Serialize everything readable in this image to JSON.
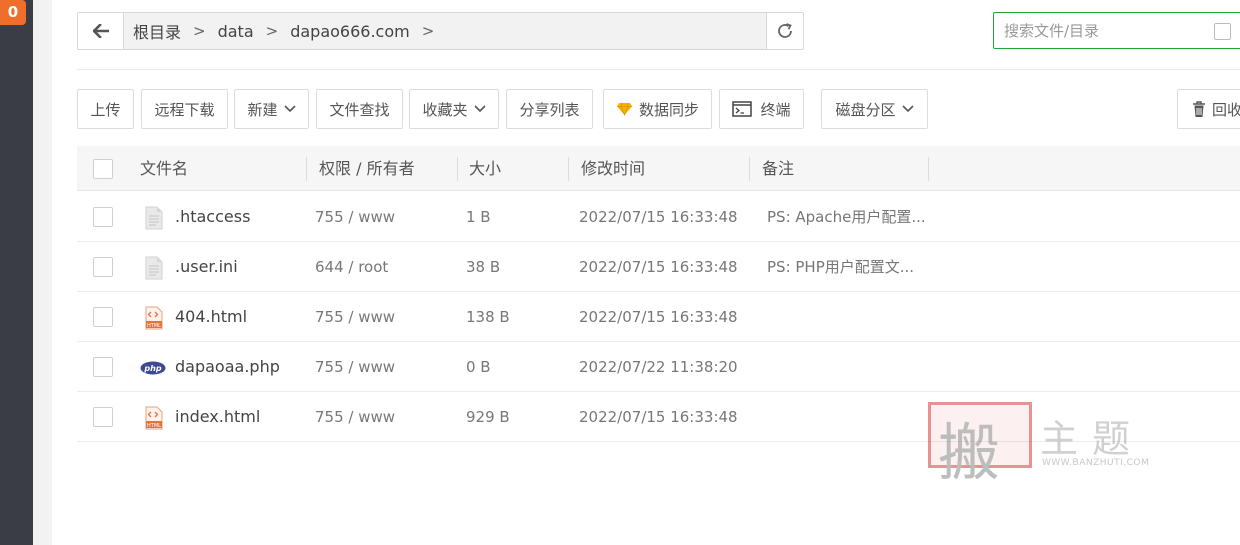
{
  "sidebar": {
    "badge": "0"
  },
  "pathbar": {
    "crumbs": [
      "根目录",
      "data",
      "dapao666.com"
    ],
    "separator": ">"
  },
  "search": {
    "placeholder": "搜索文件/目录"
  },
  "toolbar": {
    "upload": "上传",
    "remote_download": "远程下载",
    "new": "新建",
    "file_search": "文件查找",
    "favorites": "收藏夹",
    "share_list": "分享列表",
    "data_sync": "数据同步",
    "terminal": "终端",
    "disk_partition": "磁盘分区",
    "recycle": "回收"
  },
  "table": {
    "headers": {
      "name": "文件名",
      "perm": "权限 / 所有者",
      "size": "大小",
      "mtime": "修改时间",
      "note": "备注"
    },
    "rows": [
      {
        "icon": "text-file-icon",
        "name": ".htaccess",
        "perm": "755 / www",
        "size": "1 B",
        "mtime": "2022/07/15 16:33:48",
        "note": "PS: Apache用户配置..."
      },
      {
        "icon": "text-file-icon",
        "name": ".user.ini",
        "perm": "644 / root",
        "size": "38 B",
        "mtime": "2022/07/15 16:33:48",
        "note": "PS: PHP用户配置文..."
      },
      {
        "icon": "html-file-icon",
        "name": "404.html",
        "perm": "755 / www",
        "size": "138 B",
        "mtime": "2022/07/15 16:33:48",
        "note": ""
      },
      {
        "icon": "php-file-icon",
        "name": "dapaoaa.php",
        "perm": "755 / www",
        "size": "0 B",
        "mtime": "2022/07/22 11:38:20",
        "note": ""
      },
      {
        "icon": "html-file-icon",
        "name": "index.html",
        "perm": "755 / www",
        "size": "929 B",
        "mtime": "2022/07/15 16:33:48",
        "note": ""
      }
    ]
  },
  "watermark": {
    "seal": "搬",
    "text": "主题",
    "url": "WWW.BANZHUTI.COM"
  },
  "colors": {
    "accent": "#20a53a",
    "badge": "#ef6e2a",
    "sidebar": "#3a3d45"
  }
}
